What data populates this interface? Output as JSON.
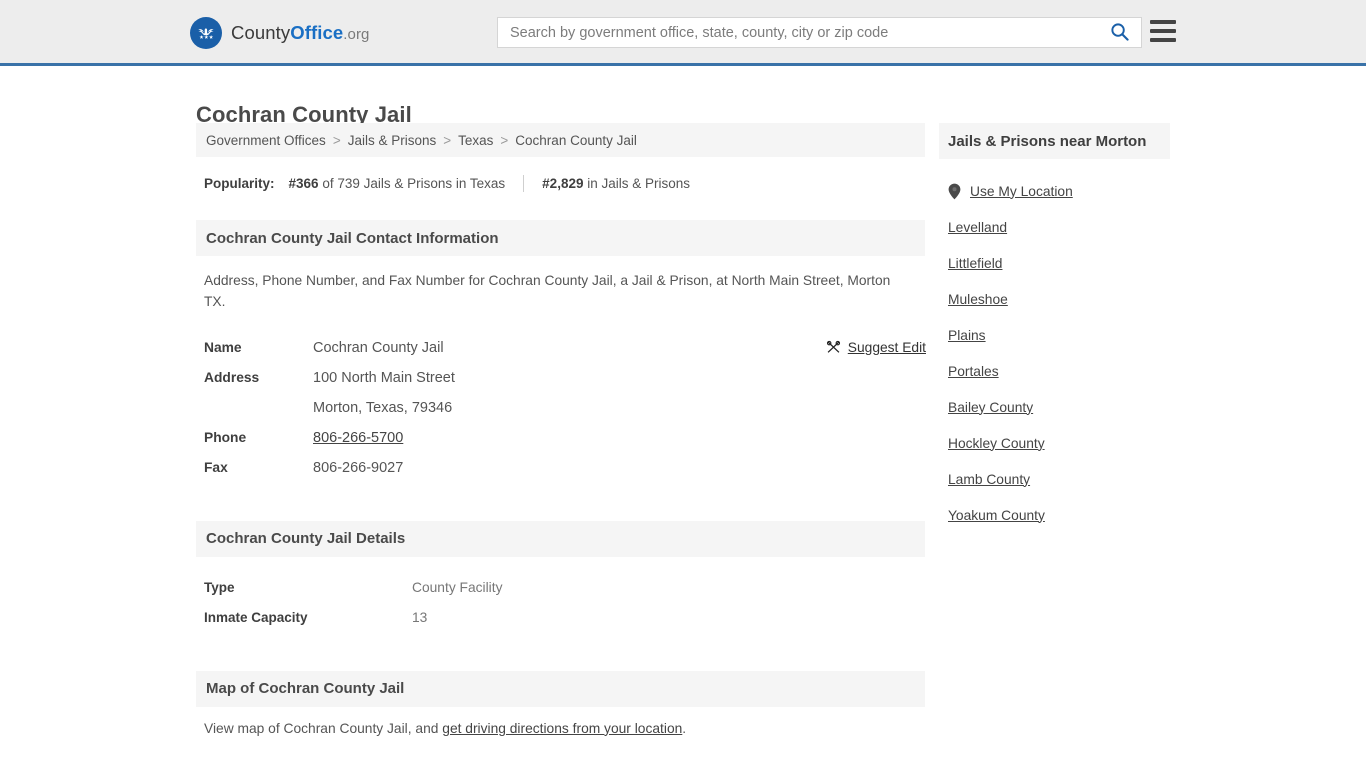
{
  "header": {
    "logo": {
      "icon": "eagle-seal-logo-icon",
      "text_1": "County",
      "text_2": "Office",
      "text_tld": ".org"
    },
    "search": {
      "placeholder": "Search by government office, state, county, city or zip code",
      "value": "",
      "button_icon": "search-icon"
    },
    "menu_icon": "hamburger-menu-icon"
  },
  "page": {
    "title": "Cochran County Jail"
  },
  "breadcrumb": {
    "separator": ">",
    "items": [
      {
        "label": "Government Offices",
        "current": false
      },
      {
        "label": "Jails & Prisons",
        "current": false
      },
      {
        "label": "Texas",
        "current": false
      },
      {
        "label": "Cochran County Jail",
        "current": true
      }
    ]
  },
  "popularity": {
    "label": "Popularity:",
    "state_rank": "#366",
    "state_text": "of 739 Jails & Prisons in Texas",
    "national_rank": "#2,829",
    "national_text": "in Jails & Prisons"
  },
  "contact_section": {
    "heading": "Cochran County Jail Contact Information",
    "description": "Address, Phone Number, and Fax Number for Cochran County Jail, a Jail & Prison, at North Main Street, Morton TX.",
    "suggest_edit": {
      "label": "Suggest Edit",
      "icon": "edit-pen-icon"
    },
    "rows": [
      {
        "label": "Name",
        "value": "Cochran County Jail",
        "link": false
      },
      {
        "label": "Address",
        "value": "100 North Main Street",
        "link": false
      },
      {
        "label": "",
        "value": "Morton, Texas, 79346",
        "link": false
      },
      {
        "label": "Phone",
        "value": "806-266-5700",
        "link": true
      },
      {
        "label": "Fax",
        "value": "806-266-9027",
        "link": false
      }
    ]
  },
  "details_section": {
    "heading": "Cochran County Jail Details",
    "rows": [
      {
        "label": "Type",
        "value": "County Facility"
      },
      {
        "label": "Inmate Capacity",
        "value": "13"
      }
    ]
  },
  "map_section": {
    "heading": "Map of Cochran County Jail",
    "text_before": "View map of Cochran County Jail, and ",
    "link_text": "get driving directions from your location",
    "text_after": "."
  },
  "aside": {
    "heading": "Jails & Prisons near Morton",
    "items": [
      {
        "label": "Use My Location",
        "icon": "map-pin-icon"
      },
      {
        "label": "Levelland",
        "icon": ""
      },
      {
        "label": "Littlefield",
        "icon": ""
      },
      {
        "label": "Muleshoe",
        "icon": ""
      },
      {
        "label": "Plains",
        "icon": ""
      },
      {
        "label": "Portales",
        "icon": ""
      },
      {
        "label": "Bailey County",
        "icon": ""
      },
      {
        "label": "Hockley County",
        "icon": ""
      },
      {
        "label": "Lamb County",
        "icon": ""
      },
      {
        "label": "Yoakum County",
        "icon": ""
      }
    ]
  },
  "colors": {
    "header_bg": "#ededed",
    "header_rule": "#3a72a8",
    "band_bg": "#f5f5f5",
    "brand_blue": "#1a6fc4",
    "logo_circle": "#1a5fa8",
    "text_dark": "#4a4a4a",
    "text_body": "#555555"
  }
}
